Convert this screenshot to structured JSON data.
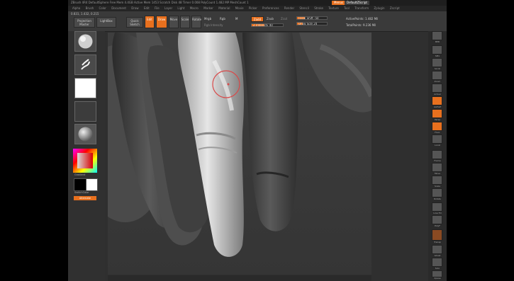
{
  "titlebar": {
    "text": "ZBrush 4R4   DefaultSphere   Free Mem 4.4GB  Active Mem 1453  Scratch Disk 48  Timer 0.008  PolyCount 1.482 MP  MeshCount 1",
    "button1": "Menus",
    "button2": "DefaultZScript"
  },
  "menubar": {
    "items": [
      "Alpha",
      "Brush",
      "Color",
      "Document",
      "Draw",
      "Edit",
      "File",
      "Layer",
      "Light",
      "Macro",
      "Marker",
      "Material",
      "Movie",
      "Picker",
      "Preferences",
      "Render",
      "Stencil",
      "Stroke",
      "Texture",
      "Tool",
      "Transform",
      "Zplugin",
      "Zscript"
    ]
  },
  "toolbar": {
    "coords": "0.831, 1.432, 0.215",
    "projection_master": "Projection Master",
    "lightbox": "LightBox",
    "quick_sketch": "Quick Sketch",
    "edit": "Edit",
    "draw": "Draw",
    "move": "Move",
    "scale": "Scale",
    "rotate": "Rotate",
    "mrgb": "Mrgb",
    "rgb": "Rgb",
    "m": "M",
    "rgb_intensity": "Rgb Intensity",
    "zadd": "Zadd",
    "zsub": "Zsub",
    "zcut": "Zcut",
    "z_intensity_label": "Z Intensity",
    "z_intensity": "40",
    "z_intensity_frac": 0.4,
    "focal_shift_label": "Focal Shift",
    "focal_shift": "-50",
    "focal_shift_frac": 0.25,
    "draw_size_label": "Draw Size",
    "draw_size": "24",
    "draw_size_frac": 0.2,
    "active_points": "ActivePoints: 1.482 Mil",
    "total_points": "TotalPoints: 9.236 Mil"
  },
  "leftshelf": {
    "gradient": "Gradient",
    "switch_color": "SwitchColor",
    "alternate": "Alternate"
  },
  "rightshelf": {
    "labels": [
      "BPR",
      "SPix",
      "Scroll",
      "Zoom",
      "Actual",
      "AAHalf",
      "Persp",
      "Floor",
      "Local",
      "Frame",
      "Move",
      "Scale",
      "Rotate",
      "Line Fill",
      "PolyF",
      "Transp",
      "Ghost",
      "Solo",
      "Xpose"
    ]
  },
  "colors": {
    "accent": "#e8701e",
    "brush_ring": "#d94a4a"
  }
}
